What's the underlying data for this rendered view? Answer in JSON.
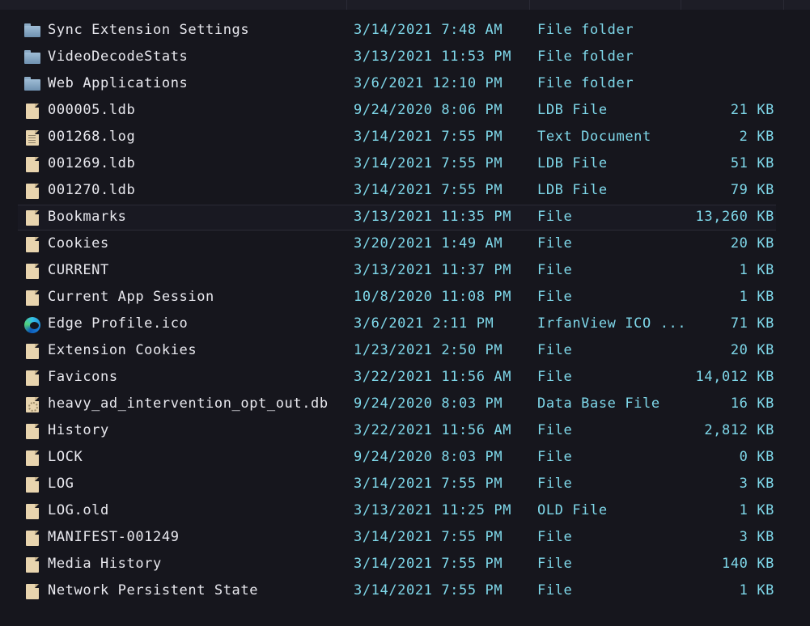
{
  "files": [
    {
      "name": "Sync Extension Settings",
      "date": "3/14/2021 7:48 AM",
      "type": "File folder",
      "size": "",
      "icon": "folder-icon"
    },
    {
      "name": "VideoDecodeStats",
      "date": "3/13/2021 11:53 PM",
      "type": "File folder",
      "size": "",
      "icon": "folder-icon"
    },
    {
      "name": "Web Applications",
      "date": "3/6/2021 12:10 PM",
      "type": "File folder",
      "size": "",
      "icon": "folder-icon"
    },
    {
      "name": "000005.ldb",
      "date": "9/24/2020 8:06 PM",
      "type": "LDB File",
      "size": "21 KB",
      "icon": "file-icon"
    },
    {
      "name": "001268.log",
      "date": "3/14/2021 7:55 PM",
      "type": "Text Document",
      "size": "2 KB",
      "icon": "text-file-icon"
    },
    {
      "name": "001269.ldb",
      "date": "3/14/2021 7:55 PM",
      "type": "LDB File",
      "size": "51 KB",
      "icon": "file-icon"
    },
    {
      "name": "001270.ldb",
      "date": "3/14/2021 7:55 PM",
      "type": "LDB File",
      "size": "79 KB",
      "icon": "file-icon"
    },
    {
      "name": "Bookmarks",
      "date": "3/13/2021 11:35 PM",
      "type": "File",
      "size": "13,260 KB",
      "icon": "file-icon",
      "hover": true
    },
    {
      "name": "Cookies",
      "date": "3/20/2021 1:49 AM",
      "type": "File",
      "size": "20 KB",
      "icon": "file-icon"
    },
    {
      "name": "CURRENT",
      "date": "3/13/2021 11:37 PM",
      "type": "File",
      "size": "1 KB",
      "icon": "file-icon"
    },
    {
      "name": "Current App Session",
      "date": "10/8/2020 11:08 PM",
      "type": "File",
      "size": "1 KB",
      "icon": "file-icon"
    },
    {
      "name": "Edge Profile.ico",
      "date": "3/6/2021 2:11 PM",
      "type": "IrfanView ICO ...",
      "size": "71 KB",
      "icon": "edge-icon"
    },
    {
      "name": "Extension Cookies",
      "date": "1/23/2021 2:50 PM",
      "type": "File",
      "size": "20 KB",
      "icon": "file-icon"
    },
    {
      "name": "Favicons",
      "date": "3/22/2021 11:56 AM",
      "type": "File",
      "size": "14,012 KB",
      "icon": "file-icon"
    },
    {
      "name": "heavy_ad_intervention_opt_out.db",
      "date": "9/24/2020 8:03 PM",
      "type": "Data Base File",
      "size": "16 KB",
      "icon": "database-file-icon"
    },
    {
      "name": "History",
      "date": "3/22/2021 11:56 AM",
      "type": "File",
      "size": "2,812 KB",
      "icon": "file-icon"
    },
    {
      "name": "LOCK",
      "date": "9/24/2020 8:03 PM",
      "type": "File",
      "size": "0 KB",
      "icon": "file-icon"
    },
    {
      "name": "LOG",
      "date": "3/14/2021 7:55 PM",
      "type": "File",
      "size": "3 KB",
      "icon": "file-icon"
    },
    {
      "name": "LOG.old",
      "date": "3/13/2021 11:25 PM",
      "type": "OLD File",
      "size": "1 KB",
      "icon": "file-icon"
    },
    {
      "name": "MANIFEST-001249",
      "date": "3/14/2021 7:55 PM",
      "type": "File",
      "size": "3 KB",
      "icon": "file-icon"
    },
    {
      "name": "Media History",
      "date": "3/14/2021 7:55 PM",
      "type": "File",
      "size": "140 KB",
      "icon": "file-icon"
    },
    {
      "name": "Network Persistent State",
      "date": "3/14/2021 7:55 PM",
      "type": "File",
      "size": "1 KB",
      "icon": "file-icon"
    }
  ]
}
